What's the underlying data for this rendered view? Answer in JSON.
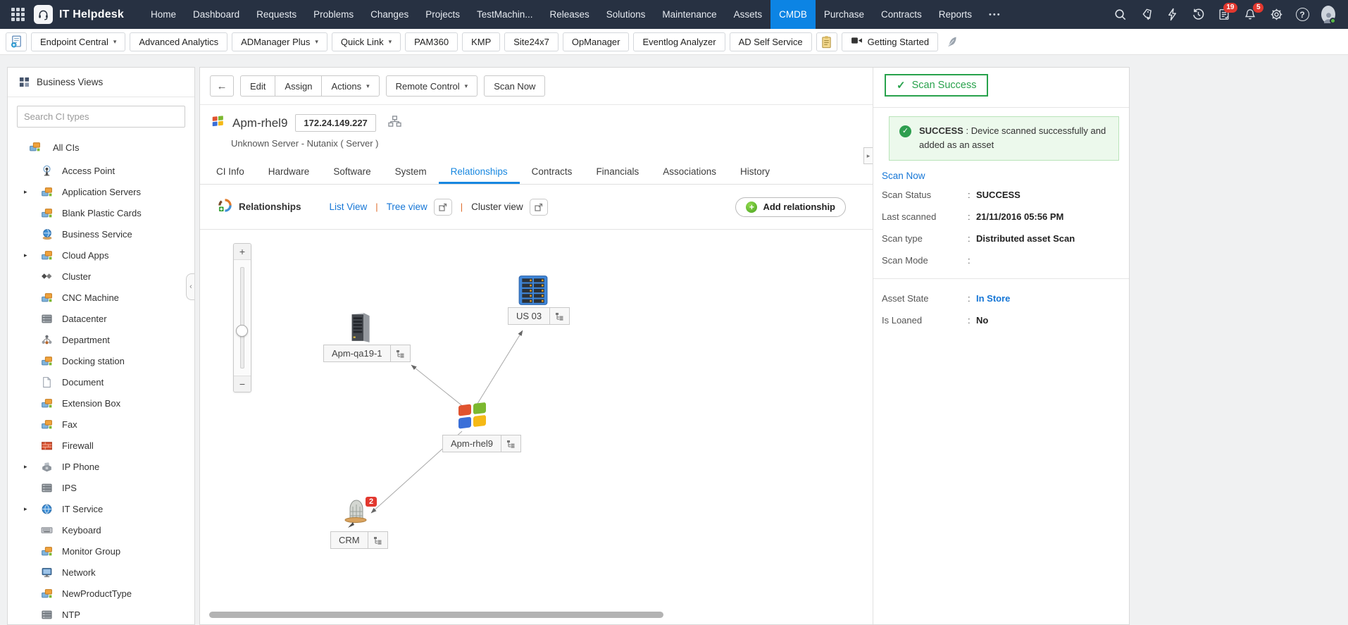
{
  "glyphs": {
    "more": "•••",
    "caret": "▾",
    "back": "←",
    "pipe": "|",
    "plus": "+",
    "minus": "−",
    "check": "✓",
    "collapse": "‹",
    "expand": "▸",
    "help": "?"
  },
  "colors": {
    "accent_blue": "#0c84e4",
    "link_blue": "#1576d6",
    "success_green": "#28a24c",
    "badge_red": "#e2382f"
  },
  "topnav": {
    "brand": "IT Helpdesk",
    "items": [
      {
        "label": "Home"
      },
      {
        "label": "Dashboard"
      },
      {
        "label": "Requests"
      },
      {
        "label": "Problems"
      },
      {
        "label": "Changes"
      },
      {
        "label": "Projects"
      },
      {
        "label": "TestMachin..."
      },
      {
        "label": "Releases"
      },
      {
        "label": "Solutions"
      },
      {
        "label": "Maintenance"
      },
      {
        "label": "Assets"
      },
      {
        "label": "CMDB",
        "active": true
      },
      {
        "label": "Purchase"
      },
      {
        "label": "Contracts"
      },
      {
        "label": "Reports"
      }
    ],
    "icons": [
      {
        "name": "search"
      },
      {
        "name": "tag-add"
      },
      {
        "name": "bolt"
      },
      {
        "name": "history"
      },
      {
        "name": "task-list",
        "badge": "19"
      },
      {
        "name": "bell",
        "badge": "5"
      },
      {
        "name": "gear"
      },
      {
        "name": "help"
      },
      {
        "name": "avatar"
      }
    ]
  },
  "quickbar": {
    "items": [
      {
        "type": "icon",
        "name": "doc-add"
      },
      {
        "label": "Endpoint Central",
        "caret": true
      },
      {
        "label": "Advanced Analytics"
      },
      {
        "label": "ADManager Plus",
        "caret": true
      },
      {
        "label": "Quick Link",
        "caret": true
      },
      {
        "label": "PAM360"
      },
      {
        "label": "KMP"
      },
      {
        "label": "Site24x7"
      },
      {
        "label": "OpManager"
      },
      {
        "label": "Eventlog Analyzer"
      },
      {
        "label": "AD Self Service"
      },
      {
        "type": "icon",
        "name": "clipboard"
      },
      {
        "label": "Getting Started",
        "icon": "video"
      },
      {
        "type": "plain",
        "name": "quill"
      }
    ]
  },
  "sidebar": {
    "title": "Business Views",
    "search_placeholder": "Search CI types",
    "root": {
      "label": "All CIs",
      "icon": "boxes"
    },
    "items": [
      {
        "label": "Access Point",
        "icon": "antenna"
      },
      {
        "label": "Application Servers",
        "icon": "boxes",
        "expandable": true
      },
      {
        "label": "Blank Plastic Cards",
        "icon": "boxes"
      },
      {
        "label": "Business Service",
        "icon": "globe-hand"
      },
      {
        "label": "Cloud Apps",
        "icon": "boxes",
        "expandable": true
      },
      {
        "label": "Cluster",
        "icon": "cluster"
      },
      {
        "label": "CNC Machine",
        "icon": "boxes"
      },
      {
        "label": "Datacenter",
        "icon": "server"
      },
      {
        "label": "Department",
        "icon": "org"
      },
      {
        "label": "Docking station",
        "icon": "boxes"
      },
      {
        "label": "Document",
        "icon": "doc"
      },
      {
        "label": "Extension Box",
        "icon": "boxes"
      },
      {
        "label": "Fax",
        "icon": "boxes"
      },
      {
        "label": "Firewall",
        "icon": "firewall"
      },
      {
        "label": "IP Phone",
        "icon": "phone",
        "expandable": true
      },
      {
        "label": "IPS",
        "icon": "server"
      },
      {
        "label": "IT Service",
        "icon": "globe",
        "expandable": true
      },
      {
        "label": "Keyboard",
        "icon": "keyboard"
      },
      {
        "label": "Monitor Group",
        "icon": "boxes"
      },
      {
        "label": "Network",
        "icon": "monitor"
      },
      {
        "label": "NewProductType",
        "icon": "boxes"
      },
      {
        "label": "NTP",
        "icon": "server"
      }
    ]
  },
  "toolbar": {
    "edit": "Edit",
    "assign": "Assign",
    "actions": "Actions",
    "remote_control": "Remote Control",
    "scan_now": "Scan Now"
  },
  "asset": {
    "name": "Apm-rhel9",
    "ip": "172.24.149.227",
    "subtitle": "Unknown Server - Nutanix ( Server )"
  },
  "tabs": [
    {
      "label": "CI Info"
    },
    {
      "label": "Hardware"
    },
    {
      "label": "Software"
    },
    {
      "label": "System"
    },
    {
      "label": "Relationships",
      "active": true
    },
    {
      "label": "Contracts"
    },
    {
      "label": "Financials"
    },
    {
      "label": "Associations"
    },
    {
      "label": "History"
    }
  ],
  "relationships": {
    "title": "Relationships",
    "views": [
      {
        "label": "List View",
        "style": "link"
      },
      {
        "label": "Tree view",
        "style": "link",
        "popout": true
      },
      {
        "label": "Cluster view",
        "style": "dark",
        "popout": true
      }
    ],
    "add_button": "Add relationship",
    "nodes": [
      {
        "id": "us03",
        "label": "US 03",
        "icon": "rack"
      },
      {
        "id": "qa19",
        "label": "Apm-qa19-1",
        "icon": "tower"
      },
      {
        "id": "rhel9",
        "label": "Apm-rhel9",
        "icon": "windows"
      },
      {
        "id": "crm",
        "label": "CRM",
        "icon": "service",
        "badge": "2"
      }
    ]
  },
  "scan_panel": {
    "button": "Scan Success",
    "message_title": "SUCCESS",
    "message_body": ": Device scanned successfully and added as an asset",
    "scan_now_link": "Scan Now",
    "rows": [
      {
        "label": "Scan Status",
        "value": "SUCCESS"
      },
      {
        "label": "Last scanned",
        "value": "21/11/2016 05:56 PM"
      },
      {
        "label": "Scan type",
        "value": "Distributed asset Scan"
      },
      {
        "label": "Scan Mode",
        "value": ""
      }
    ],
    "asset_rows": [
      {
        "label": "Asset State",
        "value": "In Store",
        "link": true
      },
      {
        "label": "Is Loaned",
        "value": "No"
      }
    ]
  }
}
